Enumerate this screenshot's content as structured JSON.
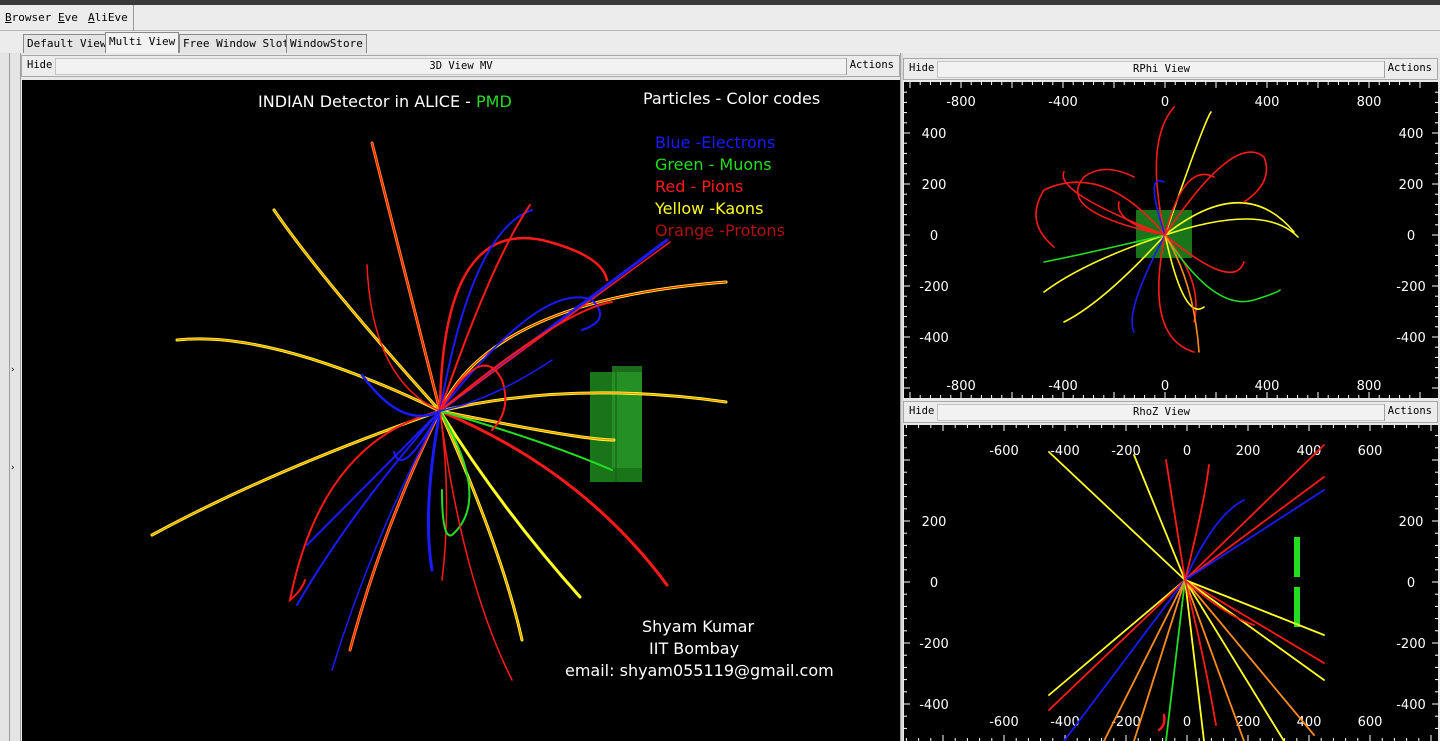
{
  "menubar": {
    "items": [
      {
        "label": "Browser",
        "u": "B",
        "rest": "rowser"
      },
      {
        "label": "Eve",
        "u": "E",
        "rest": "ve"
      },
      {
        "label": "AliEve",
        "u": "A",
        "rest": "liEve"
      }
    ]
  },
  "side_tab_label": "E",
  "tabs": [
    {
      "label": "Default View",
      "active": false
    },
    {
      "label": "Multi View",
      "active": true
    },
    {
      "label": "Free Window Slot",
      "active": false
    },
    {
      "label": "WindowStore",
      "active": false
    }
  ],
  "view3d": {
    "hide_label": "Hide",
    "title": "3D View MV",
    "actions_label": "Actions",
    "heading_prefix": "INDIAN Detector in ALICE - ",
    "heading_highlight": "PMD",
    "legend_title": "Particles - Color codes",
    "legend": [
      {
        "label": "Blue -Electrons",
        "color": "#1a1aff"
      },
      {
        "label": "Green - Muons",
        "color": "#22dd22"
      },
      {
        "label": "Red - Pions",
        "color": "#ff1a1a"
      },
      {
        "label": "Yellow -Kaons",
        "color": "#ffff22"
      },
      {
        "label": "Orange -Protons",
        "color": "#b01010"
      }
    ],
    "credit_name": "Shyam Kumar",
    "credit_institute": "IIT Bombay",
    "credit_email": "email: shyam055119@gmail.com"
  },
  "rphi": {
    "hide_label": "Hide",
    "title": "RPhi View",
    "actions_label": "Actions",
    "x_ticks": [
      "-800",
      "-400",
      "0",
      "400",
      "800"
    ],
    "y_ticks": [
      "400",
      "200",
      "0",
      "-200",
      "-400"
    ]
  },
  "rhoz": {
    "hide_label": "Hide",
    "title": "RhoZ View",
    "actions_label": "Actions",
    "x_ticks": [
      "-600",
      "-400",
      "-200",
      "0",
      "200",
      "400",
      "600"
    ],
    "y_ticks": [
      "200",
      "0",
      "-200",
      "-400"
    ]
  },
  "colors": {
    "electron": "#1a1aff",
    "muon": "#22dd22",
    "pion": "#ff1a1a",
    "kaon": "#ffff22",
    "proton": "#ff8c1a",
    "pmd_detector": "#1f8a1f"
  }
}
